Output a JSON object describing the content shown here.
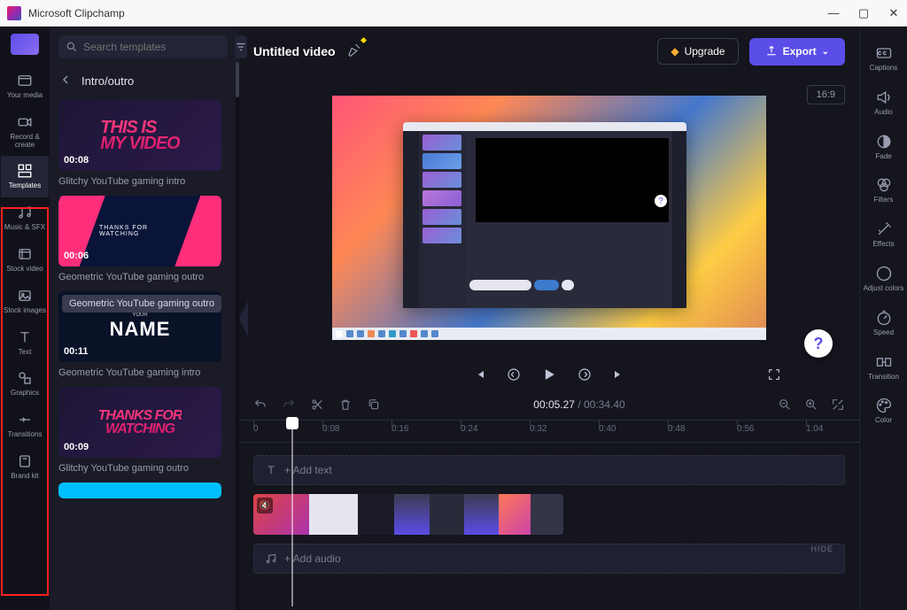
{
  "app": {
    "name": "Microsoft Clipchamp"
  },
  "window": {
    "minimize": "—",
    "maximize": "▢",
    "close": "✕"
  },
  "left_nav": {
    "items": [
      {
        "icon": "media-icon",
        "label": "Your media"
      },
      {
        "icon": "camera-icon",
        "label": "Record & create"
      },
      {
        "icon": "templates-icon",
        "label": "Templates"
      },
      {
        "icon": "music-icon",
        "label": "Music & SFX"
      },
      {
        "icon": "stock-video-icon",
        "label": "Stock video"
      },
      {
        "icon": "stock-image-icon",
        "label": "Stock images"
      },
      {
        "icon": "text-icon",
        "label": "Text"
      },
      {
        "icon": "graphics-icon",
        "label": "Graphics"
      },
      {
        "icon": "transitions-icon",
        "label": "Transitions"
      },
      {
        "icon": "brandkit-icon",
        "label": "Brand kit"
      }
    ]
  },
  "templates": {
    "search_placeholder": "Search templates",
    "breadcrumb": "Intro/outro",
    "tooltip": "Geometric YouTube gaming outro",
    "cards": [
      {
        "duration": "00:08",
        "title": "Glitchy YouTube gaming intro",
        "thumb_text": "THIS IS\nMY VIDEO"
      },
      {
        "duration": "00:06",
        "title": "Geometric YouTube gaming outro",
        "thumb_text": "THANKS FOR WATCHING"
      },
      {
        "duration": "00:11",
        "title": "Geometric YouTube gaming intro",
        "thumb_big": "NAME",
        "thumb_small": "YOUR"
      },
      {
        "duration": "00:09",
        "title": "Glitchy YouTube gaming outro",
        "thumb_text": "THANKS FOR\nWATCHING"
      }
    ]
  },
  "topbar": {
    "project_title": "Untitled video",
    "upgrade": "Upgrade",
    "export": "Export",
    "aspect": "16:9"
  },
  "player": {
    "help": "?"
  },
  "timeline": {
    "current": "00:05.27",
    "total": "00:34.40",
    "marks": [
      "0",
      "0:08",
      "0:16",
      "0:24",
      "0:32",
      "0:40",
      "0:48",
      "0:56",
      "1:04"
    ],
    "add_text": "+ Add text",
    "add_audio": "+ Add audio",
    "hide": "HIDE"
  },
  "right_panel": {
    "items": [
      {
        "label": "Captions",
        "icon": "cc-icon"
      },
      {
        "label": "Audio",
        "icon": "speaker-icon"
      },
      {
        "label": "Fade",
        "icon": "fade-icon"
      },
      {
        "label": "Filters",
        "icon": "filters-icon"
      },
      {
        "label": "Effects",
        "icon": "effects-icon"
      },
      {
        "label": "Adjust colors",
        "icon": "adjust-icon"
      },
      {
        "label": "Speed",
        "icon": "speed-icon"
      },
      {
        "label": "Transition",
        "icon": "transition-icon"
      },
      {
        "label": "Color",
        "icon": "color-icon"
      }
    ]
  }
}
